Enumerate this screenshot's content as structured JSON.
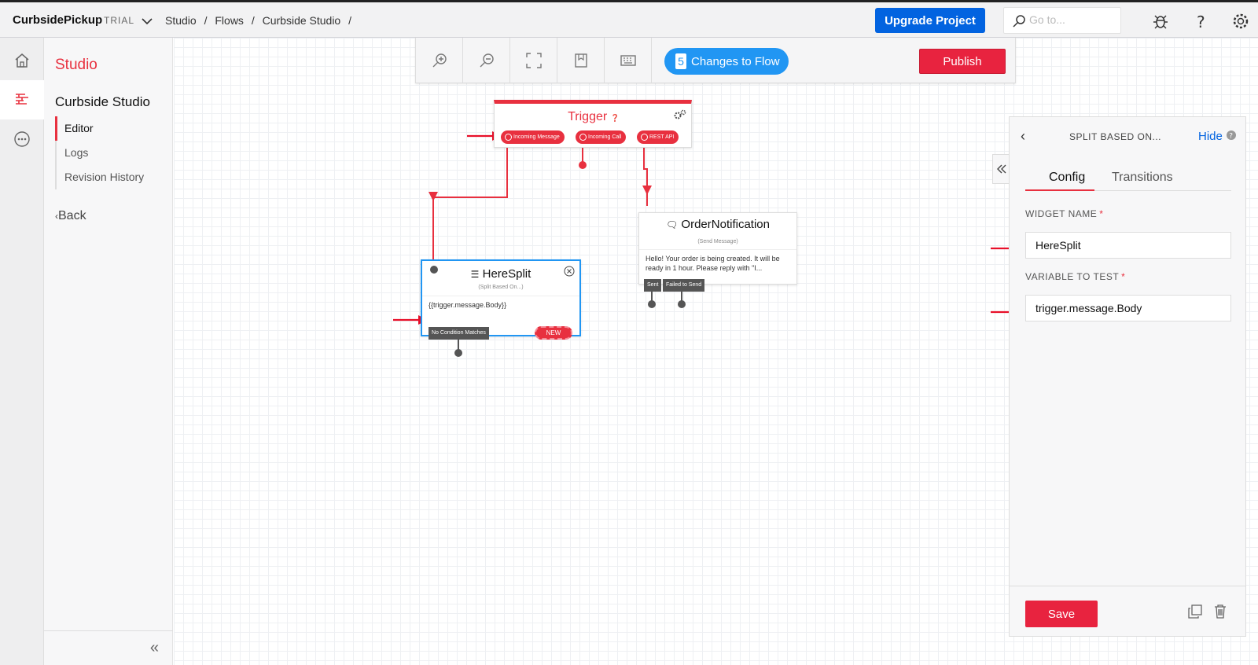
{
  "topbar": {
    "project_name": "CurbsidePickup",
    "account_type": "TRIAL",
    "breadcrumbs": [
      "Studio",
      "/",
      "Flows",
      "/",
      "Curbside Studio",
      "/"
    ],
    "upgrade_label": "Upgrade Project",
    "search_placeholder": "Go to..."
  },
  "left_nav": {
    "section_title": "Studio",
    "flow_title": "Curbside Studio",
    "items": [
      {
        "label": "Editor",
        "active": true
      },
      {
        "label": "Logs",
        "active": false
      },
      {
        "label": "Revision History",
        "active": false
      }
    ],
    "back_label": "Back",
    "collapse_label": "«"
  },
  "toolbar": {
    "changes_count": "5",
    "changes_label": "Changes to Flow",
    "publish_label": "Publish"
  },
  "widgets": {
    "trigger": {
      "title": "Trigger",
      "pills": [
        "Incoming Message",
        "Incoming Call",
        "REST API"
      ]
    },
    "heresplit": {
      "title": "HereSplit",
      "subtitle": "(Split Based On...)",
      "body": "{{trigger.message.Body}}",
      "transition": "No Condition Matches",
      "new_label": "NEW"
    },
    "order": {
      "title": "OrderNotification",
      "subtitle": "(Send Message)",
      "body": "Hello! Your order is being created. It will be ready in 1 hour. Please reply with \"I...",
      "transitions": [
        "Sent",
        "Failed to Send"
      ]
    }
  },
  "panel": {
    "title": "SPLIT BASED ON...",
    "hide_label": "Hide",
    "tabs": [
      {
        "label": "Config",
        "active": true
      },
      {
        "label": "Transitions",
        "active": false
      }
    ],
    "widget_name_label": "WIDGET NAME",
    "widget_name_value": "HereSplit",
    "variable_label": "VARIABLE TO TEST",
    "variable_value": "trigger.message.Body",
    "required_mark": "*",
    "save_label": "Save"
  },
  "colors": {
    "brand_red": "#e8303f",
    "upgrade_blue": "#0263e0",
    "changes_blue": "#2196f3",
    "selected_outline": "#2196f3"
  }
}
